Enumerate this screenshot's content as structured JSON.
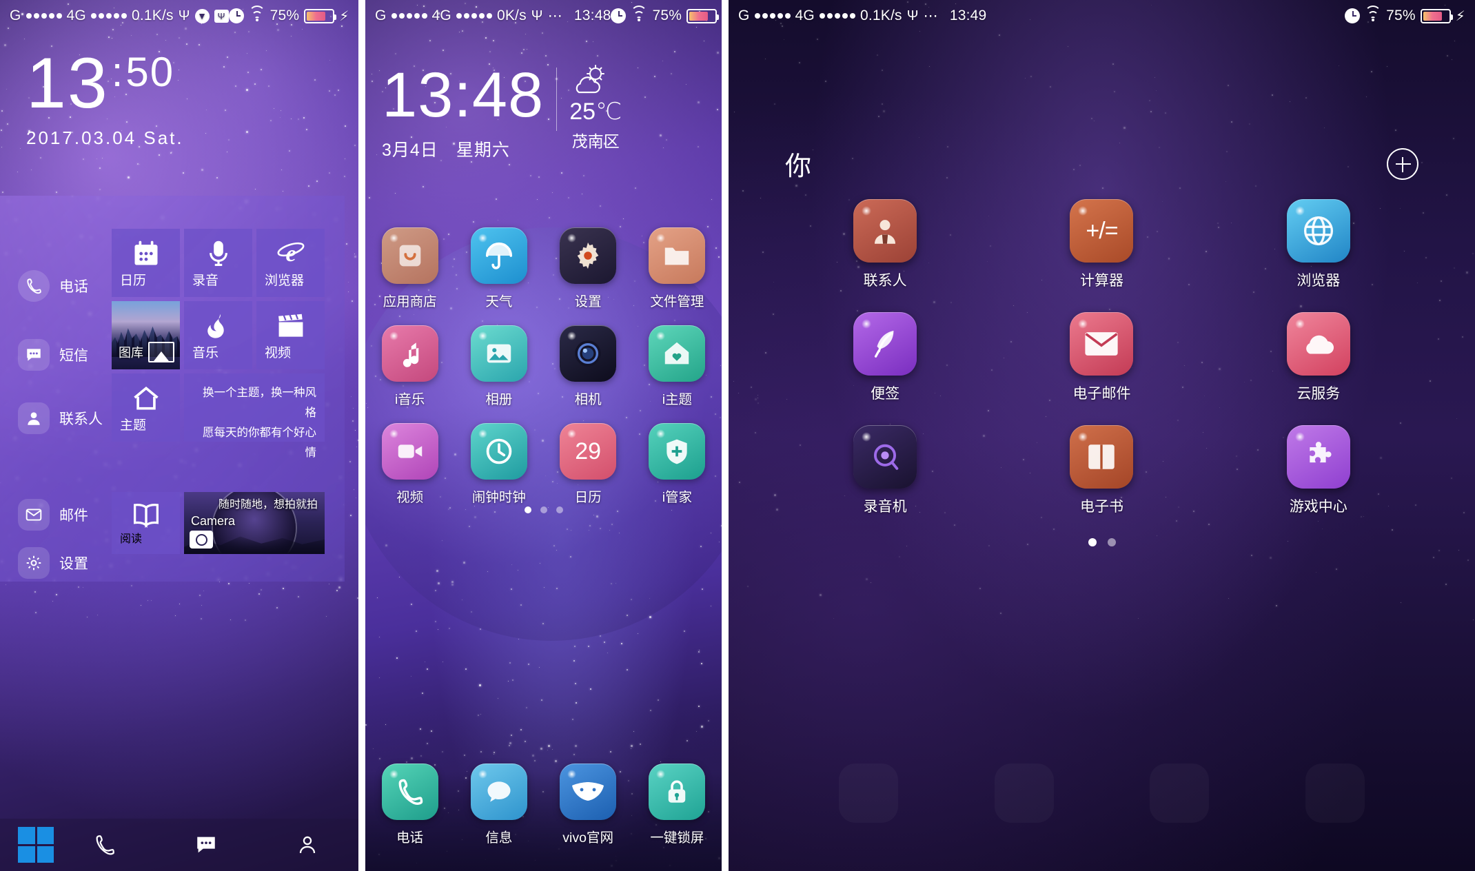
{
  "panel1": {
    "statusbar": {
      "carrier": "G",
      "network": "4G",
      "speed": "0.1K/s",
      "usb_icon": "usb-icon",
      "download_icon": "download-badge-icon",
      "usb_debug_icon": "usb-debug-icon",
      "alarm_icon": "alarm-icon",
      "wifi_icon": "wifi-icon",
      "battery_pct": "75%",
      "charging_icon": "bolt-icon"
    },
    "clock": {
      "hour": "13",
      "colon": ":",
      "minute": "50",
      "date": "2017.03.04 Sat."
    },
    "shortcuts": [
      {
        "label": "电话",
        "icon": "phone-icon"
      },
      {
        "label": "短信",
        "icon": "message-icon"
      },
      {
        "label": "联系人",
        "icon": "contacts-icon"
      },
      {
        "label": "邮件",
        "icon": "mail-icon"
      },
      {
        "label": "设置",
        "icon": "gear-icon"
      }
    ],
    "tiles": {
      "calendar": {
        "label": "日历",
        "icon": "calendar-icon"
      },
      "recorder": {
        "label": "录音",
        "icon": "microphone-icon"
      },
      "browser": {
        "label": "浏览器",
        "icon": "ie-browser-icon"
      },
      "gallery": {
        "label": "图库",
        "icon": "gallery-icon"
      },
      "music": {
        "label": "音乐",
        "icon": "music-note-icon"
      },
      "video": {
        "label": "视频",
        "icon": "clapperboard-icon"
      },
      "theme": {
        "label": "主题",
        "icon": "home-icon"
      },
      "theme_slogan_line1": "换一个主题，换一种风格",
      "theme_slogan_line2": "愿每天的你都有个好心情",
      "reading": {
        "label": "阅读",
        "icon": "book-icon"
      },
      "camera": {
        "label": "Camera",
        "tagline": "随时随地，想拍就拍",
        "icon": "camera-icon"
      }
    },
    "dock": [
      {
        "name": "windows-start",
        "icon": "windows-logo-icon"
      },
      {
        "name": "dock-phone",
        "icon": "phone-icon"
      },
      {
        "name": "dock-message",
        "icon": "message-icon"
      },
      {
        "name": "dock-contacts",
        "icon": "contacts-icon"
      }
    ]
  },
  "panel2": {
    "statusbar": {
      "carrier": "G",
      "network": "4G",
      "speed": "0K/s",
      "usb_icon": "usb-icon",
      "more_icon": "ellipsis-icon",
      "time": "13:48",
      "alarm_icon": "alarm-icon",
      "wifi_icon": "wifi-icon",
      "battery_pct": "75%",
      "charging_icon": "bolt-icon"
    },
    "clock": {
      "time": "13:48",
      "date": "3月4日",
      "weekday": "星期六"
    },
    "weather": {
      "icon": "sun-cloud-icon",
      "temp": "25℃",
      "location": "茂南区"
    },
    "apps": [
      [
        {
          "label": "应用商店",
          "icon": "app-store-icon",
          "color": "#c08a7a"
        },
        {
          "label": "天气",
          "icon": "umbrella-icon",
          "color": "#2aa6e0"
        },
        {
          "label": "设置",
          "icon": "gear-icon",
          "color": "#2a2338"
        },
        {
          "label": "文件管理",
          "icon": "folder-icon",
          "color": "#d08f78"
        }
      ],
      [
        {
          "label": "i音乐",
          "icon": "music-note-icon",
          "color": "#d8608f"
        },
        {
          "label": "相册",
          "icon": "photo-icon",
          "color": "#3fc2b8"
        },
        {
          "label": "相机",
          "icon": "camera-lens-icon",
          "color": "#1a1a2e"
        },
        {
          "label": "i主题",
          "icon": "theme-heart-icon",
          "color": "#3bbf9e"
        }
      ],
      [
        {
          "label": "视频",
          "icon": "videocam-icon",
          "color": "#c860c8"
        },
        {
          "label": "闹钟时钟",
          "icon": "clock-icon",
          "color": "#34b9b0"
        },
        {
          "label": "日历",
          "icon": "calendar-29-icon",
          "color": "#e0677d"
        },
        {
          "label": "i管家",
          "icon": "shield-health-icon",
          "color": "#2fb5a0"
        }
      ]
    ],
    "pagedots": {
      "count": 3,
      "active": 0
    },
    "dock": [
      {
        "label": "电话",
        "icon": "phone-icon",
        "color": "#2fb59a"
      },
      {
        "label": "信息",
        "icon": "chat-bubble-icon",
        "color": "#3aa8d8"
      },
      {
        "label": "vivo官网",
        "icon": "vivo-logo-icon",
        "color": "#2f7fd0"
      },
      {
        "label": "一键锁屏",
        "icon": "lock-icon",
        "color": "#33b9a8"
      }
    ]
  },
  "panel3": {
    "statusbar": {
      "carrier": "G",
      "network": "4G",
      "speed": "0.1K/s",
      "usb_icon": "usb-icon",
      "more_icon": "ellipsis-icon",
      "time": "13:49",
      "alarm_icon": "alarm-icon",
      "wifi_icon": "wifi-icon",
      "battery_pct": "75%",
      "charging_icon": "bolt-icon"
    },
    "folder": {
      "title": "你",
      "add_icon": "plus-circle-icon",
      "apps": [
        [
          {
            "label": "联系人",
            "icon": "contact-person-icon",
            "color": "#b85a4e"
          },
          {
            "label": "计算器",
            "icon": "calculator-plus-minus-icon",
            "color": "#c2603f"
          },
          {
            "label": "浏览器",
            "icon": "globe-icon",
            "color": "#3aa9dd"
          }
        ],
        [
          {
            "label": "便签",
            "icon": "feather-note-icon",
            "color": "#9d4fd4"
          },
          {
            "label": "电子邮件",
            "icon": "envelope-icon",
            "color": "#d8596d"
          },
          {
            "label": "云服务",
            "icon": "cloud-icon",
            "color": "#e0607f"
          }
        ],
        [
          {
            "label": "录音机",
            "icon": "recorder-icon",
            "color": "#2d1f52"
          },
          {
            "label": "电子书",
            "icon": "ebook-icon",
            "color": "#c05a3f"
          },
          {
            "label": "游戏中心",
            "icon": "puzzle-icon",
            "color": "#a85ad8"
          }
        ]
      ],
      "pagedots": {
        "count": 2,
        "active": 0
      }
    }
  }
}
